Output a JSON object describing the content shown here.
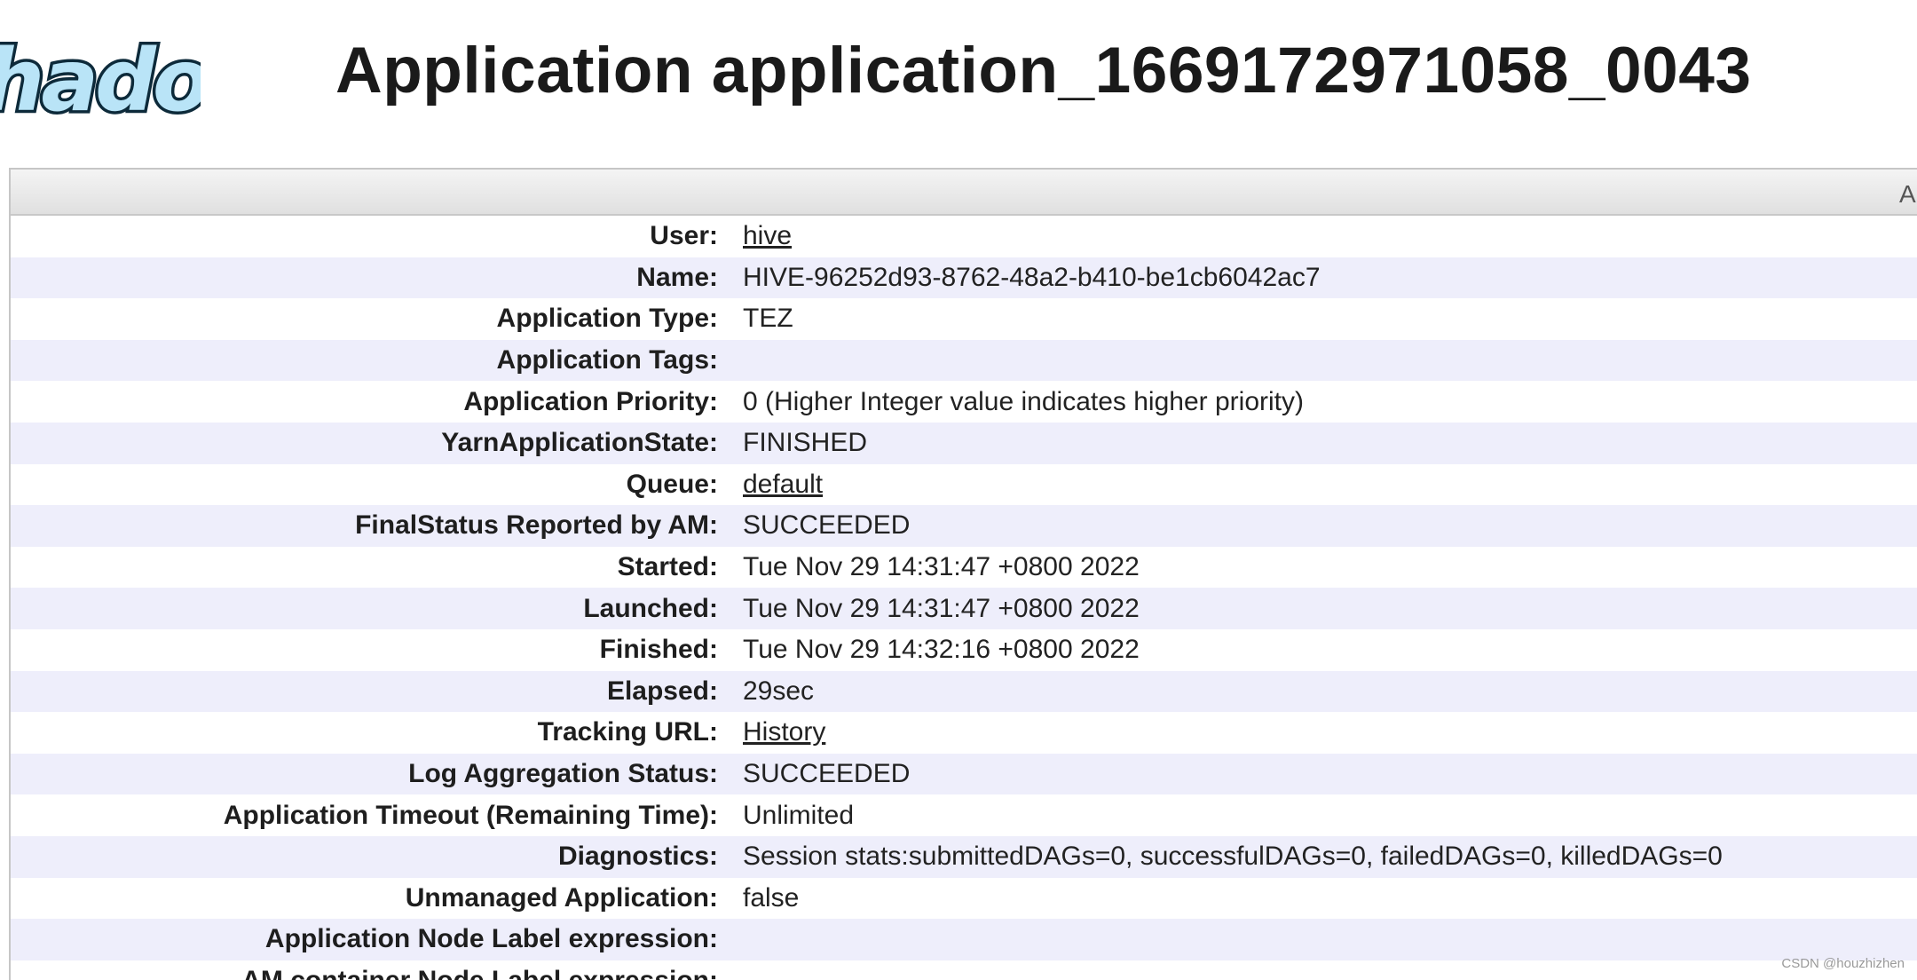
{
  "header": {
    "logo_text": "hadoop",
    "title": "Application application_1669172971058_0043"
  },
  "panel": {
    "header_label": "A"
  },
  "rows": [
    {
      "label": "User:",
      "value": "hive",
      "link": true
    },
    {
      "label": "Name:",
      "value": "HIVE-96252d93-8762-48a2-b410-be1cb6042ac7",
      "link": false
    },
    {
      "label": "Application Type:",
      "value": "TEZ",
      "link": false
    },
    {
      "label": "Application Tags:",
      "value": "",
      "link": false
    },
    {
      "label": "Application Priority:",
      "value": "0 (Higher Integer value indicates higher priority)",
      "link": false
    },
    {
      "label": "YarnApplicationState:",
      "value": "FINISHED",
      "link": false
    },
    {
      "label": "Queue:",
      "value": "default",
      "link": true
    },
    {
      "label": "FinalStatus Reported by AM:",
      "value": "SUCCEEDED",
      "link": false
    },
    {
      "label": "Started:",
      "value": "Tue Nov 29 14:31:47 +0800 2022",
      "link": false
    },
    {
      "label": "Launched:",
      "value": "Tue Nov 29 14:31:47 +0800 2022",
      "link": false
    },
    {
      "label": "Finished:",
      "value": "Tue Nov 29 14:32:16 +0800 2022",
      "link": false
    },
    {
      "label": "Elapsed:",
      "value": "29sec",
      "link": false
    },
    {
      "label": "Tracking URL:",
      "value": "History",
      "link": true
    },
    {
      "label": "Log Aggregation Status:",
      "value": "SUCCEEDED",
      "link": false
    },
    {
      "label": "Application Timeout (Remaining Time):",
      "value": "Unlimited",
      "link": false
    },
    {
      "label": "Diagnostics:",
      "value": "Session stats:submittedDAGs=0, successfulDAGs=0, failedDAGs=0, killedDAGs=0",
      "link": false
    },
    {
      "label": "Unmanaged Application:",
      "value": "false",
      "link": false
    },
    {
      "label": "Application Node Label expression:",
      "value": "",
      "link": false
    },
    {
      "label": "AM container Node Label expression:",
      "value": "",
      "link": false
    }
  ],
  "watermark": "CSDN @houzhizhen",
  "colors": {
    "row_alt": "#eeeefb",
    "logo_fill": "#b9e4f7",
    "logo_stroke": "#0d2a3a"
  }
}
